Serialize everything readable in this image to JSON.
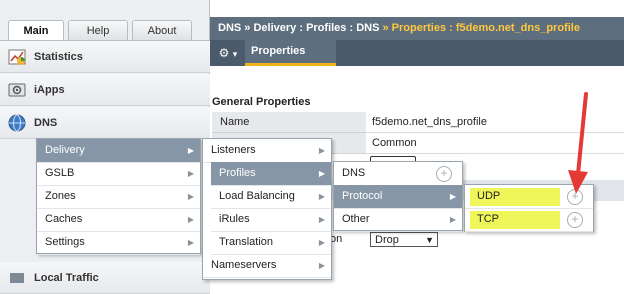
{
  "tabs": {
    "main": "Main",
    "help": "Help",
    "about": "About"
  },
  "sidebar": {
    "items": [
      {
        "label": "Statistics",
        "icon": "chart-icon"
      },
      {
        "label": "iApps",
        "icon": "iapps-icon"
      },
      {
        "label": "DNS",
        "icon": "globe-icon"
      },
      {
        "label": "Local Traffic",
        "icon": "local-traffic-icon"
      }
    ]
  },
  "breadcrumb": {
    "part1": "DNS",
    "sep": "»",
    "part2": "Delivery : Profiles : DNS",
    "part3": "Properties : f5demo.net_dns_profile"
  },
  "toolbar": {
    "gear": "⚙",
    "caret": "▾",
    "properties_tab": "Properties"
  },
  "content": {
    "section_title": "General Properties",
    "rows": [
      {
        "label": "Name",
        "value": "f5demo.net_dns_profile"
      },
      {
        "label": "",
        "value": "Common"
      }
    ],
    "drop_label": "on",
    "drop_value": "Drop"
  },
  "menus": {
    "level1": [
      "Delivery",
      "GSLB",
      "Zones",
      "Caches",
      "Settings"
    ],
    "level2": [
      "Listeners",
      "Profiles",
      "Load Balancing",
      "iRules",
      "Translation",
      "Nameservers"
    ],
    "level3": [
      "DNS",
      "Protocol",
      "Other"
    ],
    "level4": [
      "UDP",
      "TCP"
    ]
  },
  "colors": {
    "accent": "#f0b21b",
    "menu_selected": "#8796a6",
    "highlight": "#eef65a",
    "arrow": "#e53935"
  }
}
